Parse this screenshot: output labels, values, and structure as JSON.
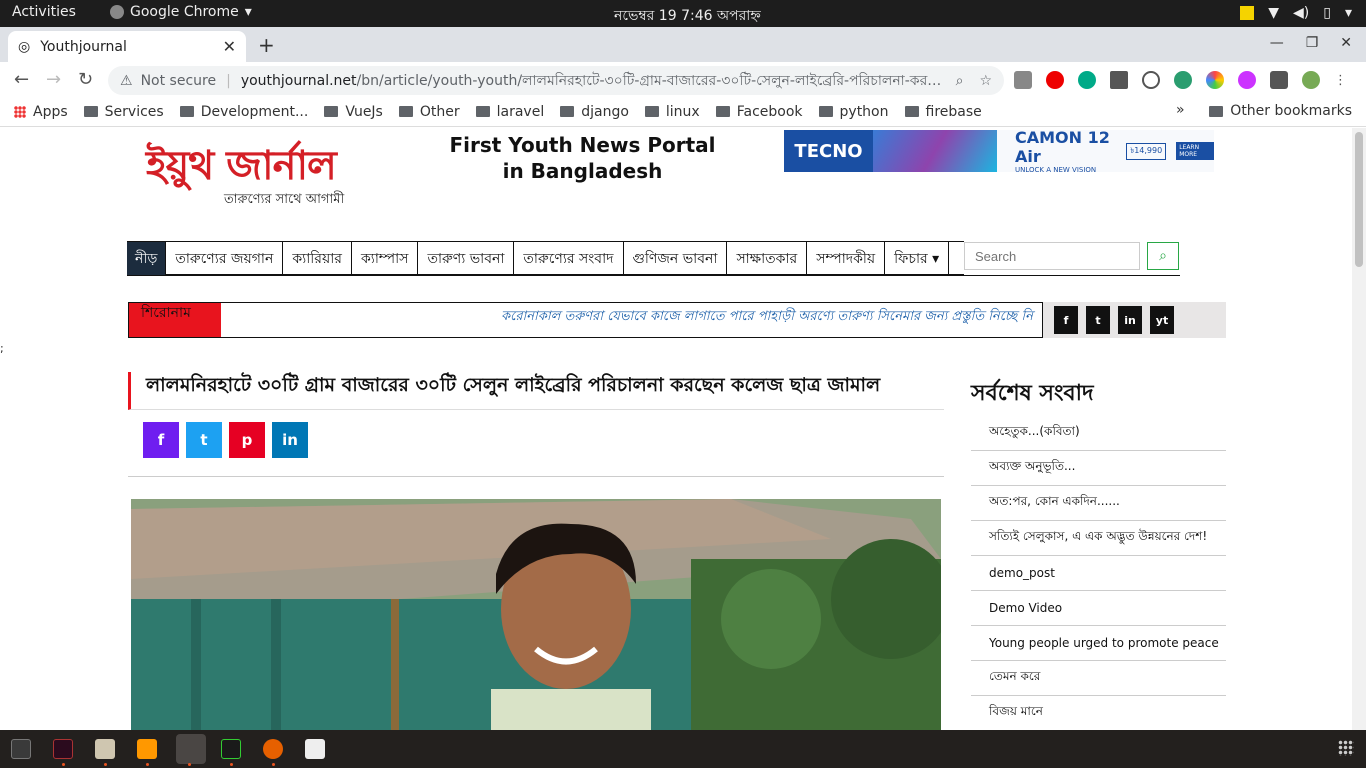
{
  "topbar": {
    "activities": "Activities",
    "app_name": "Google Chrome",
    "clock": "নভেম্বর 19  7:46 অপরাহ্ন"
  },
  "browser": {
    "tab_title": "Youthjournal",
    "address": {
      "security": "Not secure",
      "domain": "youthjournal.net",
      "path": "/bn/article/youth-youth/লালমনিরহাটে-৩০টি-গ্রাম-বাজারের-৩০টি-সেলুন-লাইব্রেরি-পরিচালনা-করছেন-কলেজ-..."
    },
    "bookmarks": [
      "Apps",
      "Services",
      "Development...",
      "VueJs",
      "Other",
      "laravel",
      "django",
      "linux",
      "Facebook",
      "python",
      "firebase"
    ],
    "bookmarks_overflow": "»",
    "other_bookmarks": "Other bookmarks"
  },
  "site": {
    "logo_main": "ইয়ুথ জার্নাল",
    "logo_tagline": "তারুণ্যের সাথে আগামী",
    "header_slogan": "First Youth News Portal in Bangladesh",
    "ad": {
      "brand": "TECNO",
      "model": "CAMON 12 Air",
      "tagline": "UNLOCK A NEW VISION",
      "price": "৳14,990",
      "cta": "LEARN MORE"
    },
    "nav": [
      "নীড়",
      "তারুণ্যের জয়গান",
      "ক্যারিয়ার",
      "ক্যাম্পাস",
      "তারুণ্য ভাবনা",
      "তারুণ্যের সংবাদ",
      "গুণিজন ভাবনা",
      "সাক্ষাতকার",
      "সম্পাদকীয়",
      "ফিচার ▾"
    ],
    "search_placeholder": "Search",
    "ticker_label": "শিরোনাম",
    "ticker_text": "করোনাকাল তরুণরা যেভাবে কাজে লাগাতে পারে  পাহাড়ী অরণ্যে তারুণ্য  সিনেমার জন্য প্রস্তুতি নিচ্ছে নি",
    "social": [
      "f",
      "t",
      "in",
      "yt"
    ],
    "stray_char": ";",
    "article_title": "লালমনিরহাটে ৩০টি গ্রাম বাজারের ৩০টি সেলুন লাইব্রেরি পরিচালনা করছেন কলেজ ছাত্র জামাল",
    "share": [
      "f",
      "t",
      "p",
      "in"
    ],
    "latest_heading": "সর্বশেষ সংবাদ",
    "latest": [
      "অহেতুক...(কবিতা)",
      "অব্যক্ত অনুভূতি...",
      "অত:পর, কোন একদিন......",
      "সত্যিই সেলুকাস, এ এক অদ্ভুত উন্নয়নের দেশ!",
      "demo_post",
      "Demo Video",
      "Young people urged to promote peace",
      "তেমন করে",
      "বিজয় মানে"
    ]
  },
  "colors": {
    "brand_red": "#d41f26",
    "nav_active": "#1c2c3e",
    "ticker_red": "#e8141e",
    "link_blue": "#1a5ea8"
  }
}
